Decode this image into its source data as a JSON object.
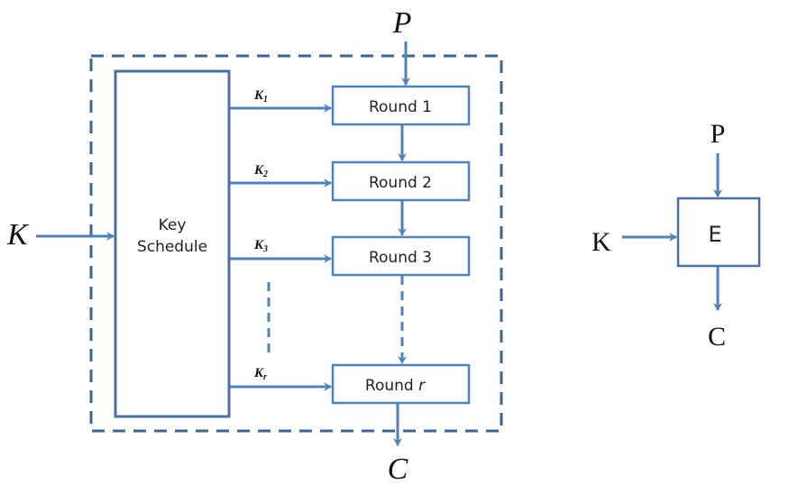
{
  "colors": {
    "line": "#4f81bd",
    "dashed_border": "#3c6496",
    "text": "#111111"
  },
  "left_diagram": {
    "plaintext_label": "P",
    "ciphertext_label": "C",
    "key_label": "K",
    "key_schedule_label_line1": "Key",
    "key_schedule_label_line2": "Schedule",
    "rounds": [
      {
        "label": "Round 1",
        "subkey": "K",
        "subkey_sub": "1"
      },
      {
        "label": "Round 2",
        "subkey": "K",
        "subkey_sub": "2"
      },
      {
        "label": "Round 3",
        "subkey": "K",
        "subkey_sub": "3"
      },
      {
        "label": "Round ",
        "label_italic": "r",
        "subkey": "K",
        "subkey_sub": "r"
      }
    ]
  },
  "right_diagram": {
    "plaintext_label": "P",
    "ciphertext_label": "C",
    "key_label": "K",
    "block_label": "E"
  }
}
